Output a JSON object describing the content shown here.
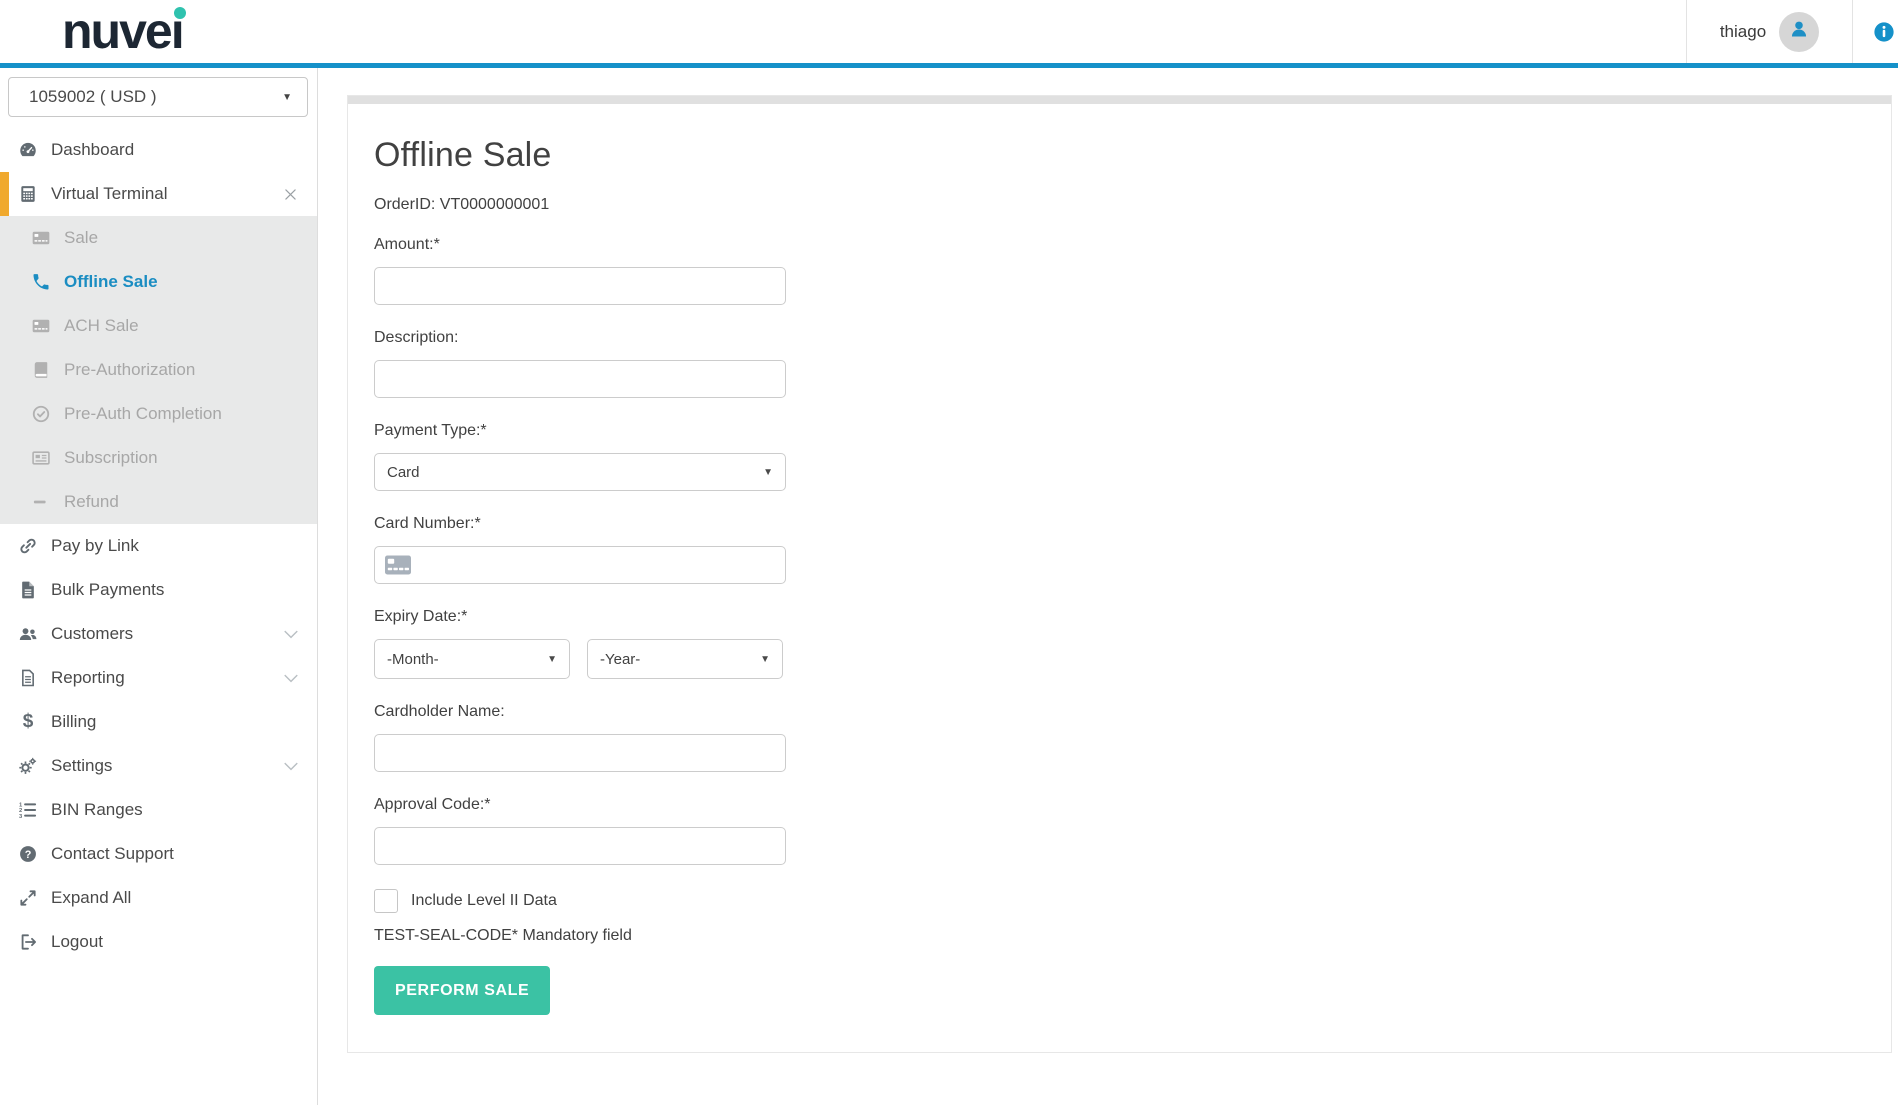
{
  "header": {
    "logo_text": "nuvei",
    "username": "thiago"
  },
  "icons": {
    "caret_down": "▼"
  },
  "colors": {
    "header_accent_blue": "#1591c9",
    "link_blue": "#1b8dc2",
    "active_yellow": "#f0a92e",
    "button_teal": "#3bc2a4",
    "logo_navy": "#1d2733",
    "logo_dot_teal": "#2fc2ae",
    "submenu_gray": "#e8e9e9"
  },
  "sidebar": {
    "merchant_select": {
      "value": "1059002 ( USD )"
    },
    "items": [
      {
        "icon": "dashboard",
        "label": "Dashboard"
      },
      {
        "icon": "calculator",
        "label": "Virtual Terminal",
        "active": true,
        "close_icon": true
      },
      {
        "icon": "credit-card",
        "label": "Sale",
        "sub": true,
        "disabled": true
      },
      {
        "icon": "phone",
        "label": "Offline Sale",
        "sub": true,
        "selected": true
      },
      {
        "icon": "credit-card",
        "label": "ACH Sale",
        "sub": true,
        "disabled": true
      },
      {
        "icon": "book",
        "label": "Pre-Authorization",
        "sub": true,
        "disabled": true
      },
      {
        "icon": "check-circle",
        "label": "Pre-Auth Completion",
        "sub": true,
        "disabled": true
      },
      {
        "icon": "newspaper",
        "label": "Subscription",
        "sub": true,
        "disabled": true
      },
      {
        "icon": "minus",
        "label": "Refund",
        "sub": true,
        "disabled": true
      },
      {
        "icon": "link",
        "label": "Pay by Link"
      },
      {
        "icon": "file",
        "label": "Bulk Payments"
      },
      {
        "icon": "users",
        "label": "Customers",
        "chevron": true
      },
      {
        "icon": "report",
        "label": "Reporting",
        "chevron": true
      },
      {
        "icon": "dollar",
        "label": "Billing"
      },
      {
        "icon": "gears",
        "label": "Settings",
        "chevron": true
      },
      {
        "icon": "ordered-list",
        "label": "BIN Ranges"
      },
      {
        "icon": "question-circle",
        "label": "Contact Support"
      },
      {
        "icon": "expand",
        "label": "Expand All"
      },
      {
        "icon": "logout",
        "label": "Logout"
      }
    ]
  },
  "main": {
    "title": "Offline Sale",
    "order_id": "OrderID: VT0000000001",
    "form": {
      "amount": {
        "label": "Amount:*",
        "value": ""
      },
      "description": {
        "label": "Description:",
        "value": ""
      },
      "payment_type": {
        "label": "Payment Type:*",
        "value": "Card"
      },
      "card_number": {
        "label": "Card Number:*",
        "value": ""
      },
      "expiry_date": {
        "label": "Expiry Date:*",
        "month_value": "-Month-",
        "year_value": "-Year-"
      },
      "cardholder_name": {
        "label": "Cardholder Name:",
        "value": ""
      },
      "approval_code": {
        "label": "Approval Code:*",
        "value": ""
      },
      "include_level2": {
        "label": "Include Level II Data",
        "checked": false
      },
      "mandatory_note": "TEST-SEAL-CODE* Mandatory field",
      "submit_label": "PERFORM SALE"
    }
  }
}
